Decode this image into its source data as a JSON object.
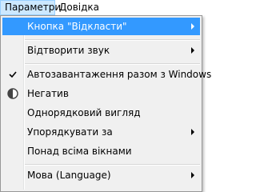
{
  "menubar": {
    "items": [
      {
        "label": "Параметри",
        "active": true
      },
      {
        "label": "Довідка",
        "active": false
      }
    ]
  },
  "menu": {
    "items": [
      {
        "label": "Кнопка \"Відкласти\"",
        "submenu": true,
        "highlighted": true
      },
      {
        "label": "Відтворити звук",
        "submenu": true
      },
      {
        "label": "Автозавантаження разом з Windows",
        "checked": true
      },
      {
        "label": "Негатив",
        "icon": "contrast-icon"
      },
      {
        "label": "Однорядковий вигляд"
      },
      {
        "label": "Упорядкувати за",
        "submenu": true
      },
      {
        "label": "Понад всіма вікнами"
      },
      {
        "label": "Мова (Language)",
        "submenu": true
      }
    ]
  },
  "colors": {
    "highlight": "#3399ff",
    "menubar_active": "#cce8ff",
    "menu_background": "#f0f0f0"
  }
}
